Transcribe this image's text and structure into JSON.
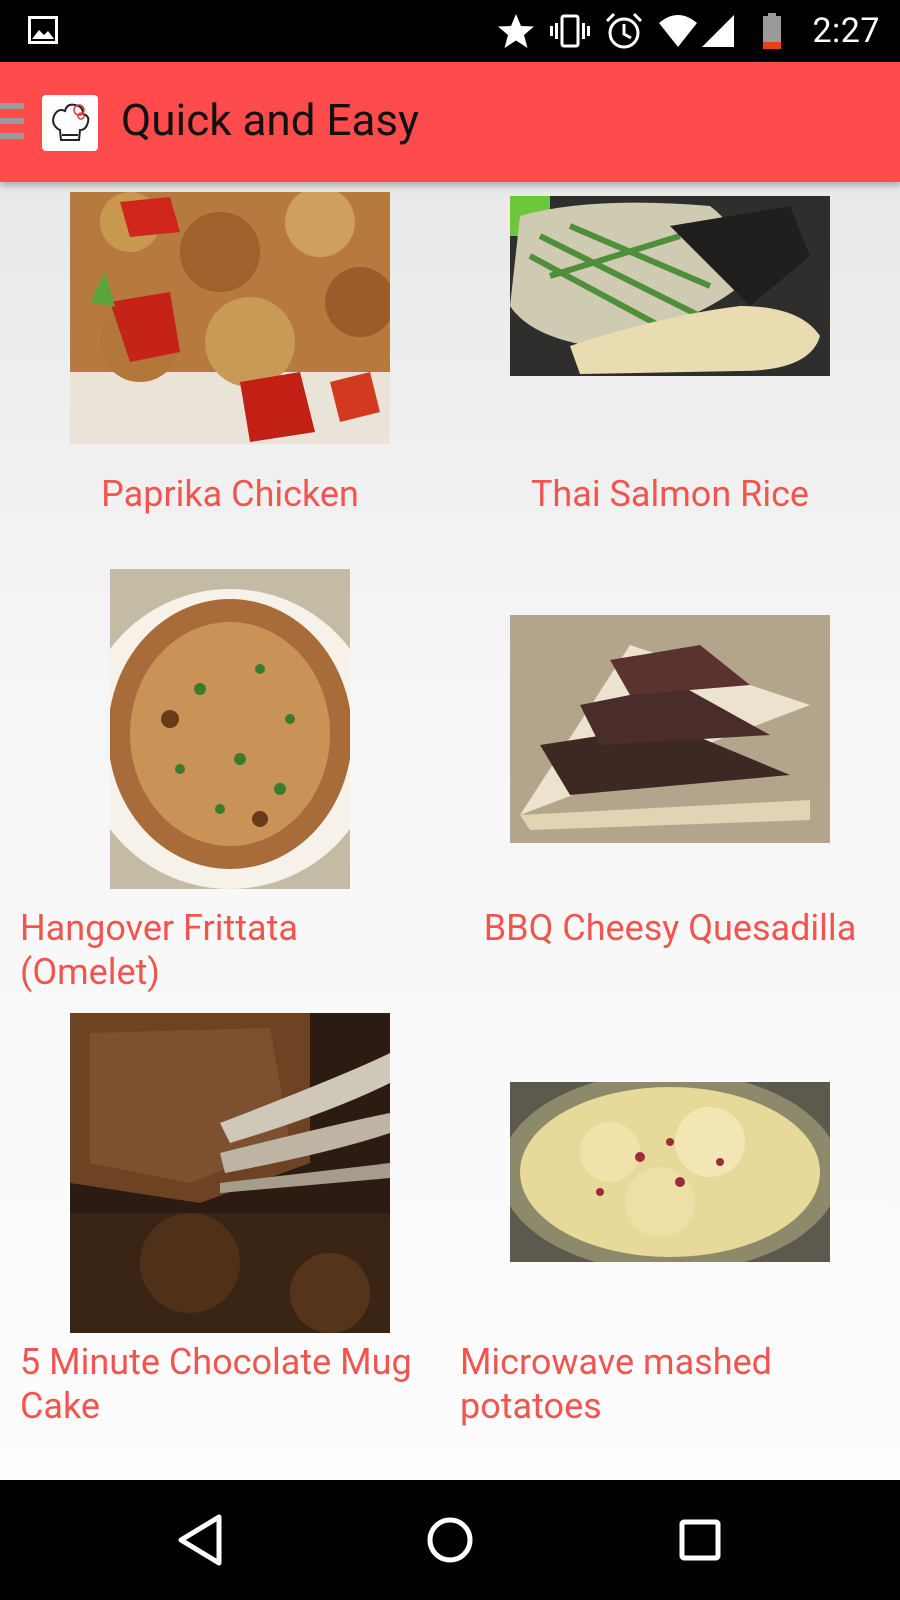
{
  "status_bar": {
    "time": "2:27",
    "icons": [
      "gallery-icon",
      "star-icon",
      "vibrate-icon",
      "alarm-icon",
      "wifi-icon",
      "signal-icon",
      "battery-icon"
    ]
  },
  "app_bar": {
    "title": "Quick and Easy",
    "icons": [
      "hamburger-icon",
      "chef-hat-logo"
    ],
    "accent_color": "#ff4b4b"
  },
  "recipes": [
    {
      "title": "Paprika Chicken",
      "image": "pasta-chicken-photo"
    },
    {
      "title": "Thai Salmon Rice",
      "image": "salmon-rice-photo"
    },
    {
      "title": "Hangover Frittata (Omelet)",
      "image": "frittata-photo"
    },
    {
      "title": "BBQ Cheesy Quesadilla",
      "image": "quesadilla-photo"
    },
    {
      "title": "5 Minute Chocolate Mug Cake",
      "image": "mug-cake-photo"
    },
    {
      "title": "Microwave mashed potatoes",
      "image": "mashed-potatoes-photo"
    }
  ],
  "title_color": "#f2554f",
  "nav_bar": {
    "icons": [
      "back-icon",
      "home-icon",
      "recents-icon"
    ]
  }
}
